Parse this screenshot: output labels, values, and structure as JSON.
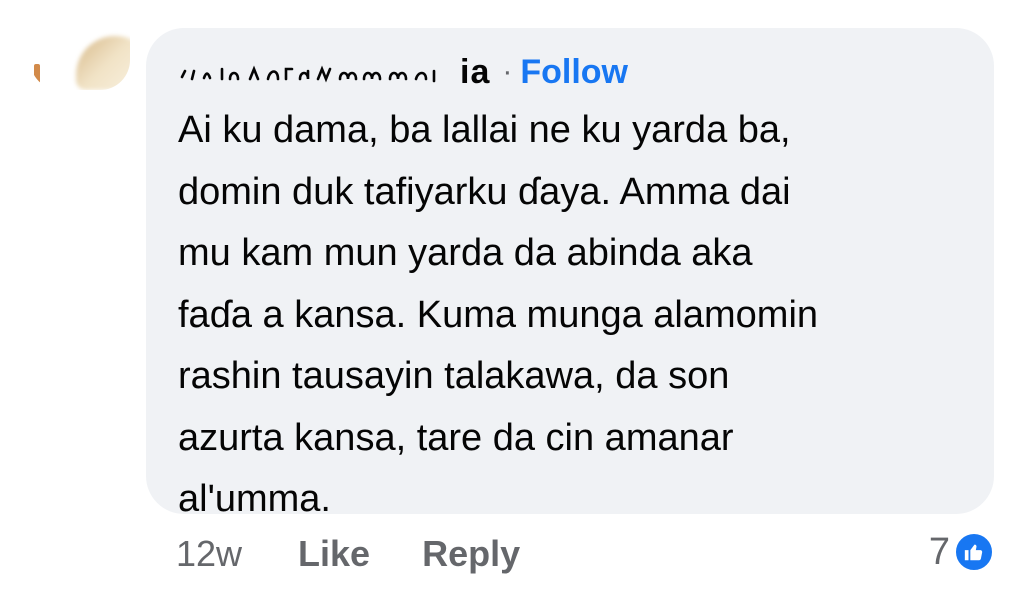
{
  "comment": {
    "author": "ia",
    "separator": "·",
    "follow_label": "Follow",
    "text": "Ai ku dama, ba lallai ne ku yarda ba,\ndomin duk tafiyarku ɗaya. Amma dai\nmu kam mun yarda  da abinda aka\nfaɗa a kansa. Kuma munga alamomin\nrashin tausayin talakawa, da son\nazurta kansa, tare da cin amanar\nal'umma."
  },
  "footer": {
    "time": "12w",
    "like_label": "Like",
    "reply_label": "Reply",
    "reaction_count": "7",
    "reaction_icon": "like-thumb-icon"
  },
  "colors": {
    "bubble": "#f0f2f5",
    "link": "#1877f2",
    "secondary_text": "#65676b",
    "primary_text": "#050505"
  }
}
